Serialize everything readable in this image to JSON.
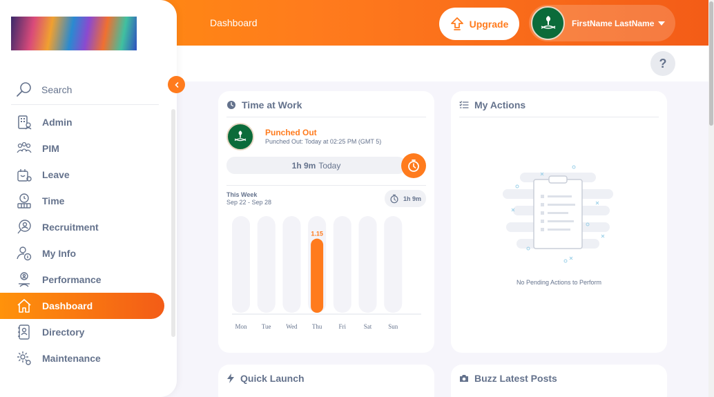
{
  "topbar": {
    "title": "Dashboard",
    "upgrade_label": "Upgrade",
    "user_name": "FirstName LastName"
  },
  "help_label": "?",
  "sidebar": {
    "search_placeholder": "Search",
    "items": [
      {
        "label": "Admin",
        "icon": "admin-icon"
      },
      {
        "label": "PIM",
        "icon": "pim-icon"
      },
      {
        "label": "Leave",
        "icon": "leave-icon"
      },
      {
        "label": "Time",
        "icon": "time-icon"
      },
      {
        "label": "Recruitment",
        "icon": "recruitment-icon"
      },
      {
        "label": "My Info",
        "icon": "my-info-icon"
      },
      {
        "label": "Performance",
        "icon": "performance-icon"
      },
      {
        "label": "Dashboard",
        "icon": "home-icon",
        "active": true
      },
      {
        "label": "Directory",
        "icon": "directory-icon"
      },
      {
        "label": "Maintenance",
        "icon": "maintenance-icon"
      }
    ]
  },
  "time_at_work": {
    "title": "Time at Work",
    "status": "Punched Out",
    "status_detail": "Punched Out: Today at 02:25 PM (GMT 5)",
    "today_hours": "1h 9m",
    "today_label": "Today",
    "week_label": "This Week",
    "week_range": "Sep 22 - Sep 28",
    "week_total": "1h 9m"
  },
  "chart_data": {
    "type": "bar",
    "categories": [
      "Mon",
      "Tue",
      "Wed",
      "Thu",
      "Fri",
      "Sat",
      "Sun"
    ],
    "values": [
      0,
      0,
      0,
      1.15,
      0,
      0,
      0
    ],
    "data_labels": [
      "",
      "",
      "",
      "1.15",
      "",
      "",
      ""
    ],
    "ylim": [
      0,
      1.5
    ],
    "color": "#ff7b1d",
    "track_color": "#f3f3f8"
  },
  "my_actions": {
    "title": "My Actions",
    "empty_text": "No Pending Actions to Perform"
  },
  "quick_launch": {
    "title": "Quick Launch"
  },
  "buzz": {
    "title": "Buzz Latest Posts"
  },
  "colors": {
    "accent": "#ff7b1d",
    "accent_dark": "#f35c17",
    "text": "#64728c",
    "background": "#f6f5fb"
  }
}
